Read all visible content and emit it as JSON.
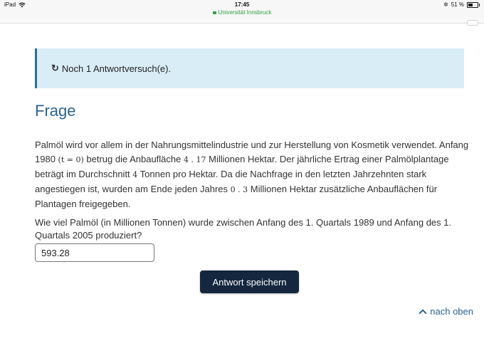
{
  "status_bar": {
    "device": "iPad",
    "time": "17:45",
    "url": "Universität Innsbruck",
    "battery": "51 %",
    "battery_level": 0.51
  },
  "alert": {
    "icon": "refresh-icon",
    "text": "Noch 1 Antwortversuch(e)."
  },
  "heading": "Frage",
  "question": {
    "p1_a": "Palmöl wird vor allem in der Nahrungsmittelindustrie und zur Herstellung von Kosmetik verwendet. Anfang 1980 ",
    "p1_math1": "(t = 0)",
    "p1_b": " betrug die Anbaufläche ",
    "p1_math2": "4 . 17",
    "p1_c": " Millionen Hektar. Der jährliche Ertrag einer Palmölplantage beträgt im Durchschnitt ",
    "p1_math3": "4",
    "p1_d": " Tonnen pro Hektar. Da die Nachfrage in den letzten Jahrzehnten stark angestiegen ist, wurden am Ende jeden Jahres ",
    "p1_math4": "0 . 3",
    "p1_e": " Millionen Hektar zusätzliche Anbauflächen für Plantagen freigegeben.",
    "ask": "Wie viel Palmöl (in Millionen Tonnen) wurde zwischen Anfang des 1. Quartals 1989 und Anfang des 1. Quartals 2005 produziert?"
  },
  "answer": {
    "value": "593.28"
  },
  "save_button": "Antwort speichern",
  "top_link": "nach oben"
}
